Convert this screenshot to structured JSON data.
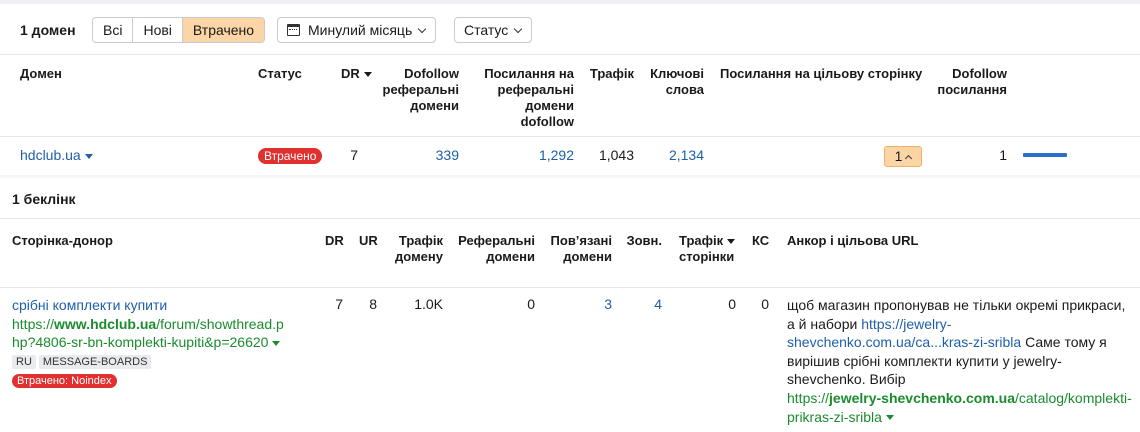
{
  "filters": {
    "count_label": "1 домен",
    "segments": [
      "Всі",
      "Нові",
      "Втрачено"
    ],
    "active_segment": "Втрачено",
    "period_label": "Минулий місяць",
    "status_label": "Статус"
  },
  "domains_table": {
    "headers": {
      "domain": "Домен",
      "status": "Статус",
      "dr": "DR",
      "dofollow_ref_domains": [
        "Dofollow",
        "реферальні",
        "домени"
      ],
      "links_to_ref_domains": [
        "Посилання на",
        "реферальні",
        "домени",
        "dofollow"
      ],
      "traffic": "Трафік",
      "keywords": [
        "Ключові",
        "слова"
      ],
      "links_to_target": "Посилання на цільову сторінку",
      "dofollow_links": [
        "Dofollow",
        "посилання"
      ]
    },
    "row": {
      "domain": "hdclub.ua",
      "status": "Втрачено",
      "dr": "7",
      "dofollow_ref_domains": "339",
      "links_to_ref_domains": "1,292",
      "traffic": "1,043",
      "keywords": "2,134",
      "links_to_target": "1",
      "dofollow_links": "1"
    }
  },
  "backlinks": {
    "title": "1 беклінк",
    "headers": {
      "donor_page": "Сторінка-донор",
      "dr": "DR",
      "ur": "UR",
      "domain_traffic": [
        "Трафік",
        "домену"
      ],
      "referring_domains": [
        "Реферальні",
        "домени"
      ],
      "linked_domains": [
        "Пов’язані",
        "домени"
      ],
      "external": "Зовн.",
      "page_traffic": [
        "Трафік",
        "сторінки"
      ],
      "kc": "КС",
      "anchor_target": "Анкор і цільова URL"
    },
    "row": {
      "page_title": "срібні комплекти купити",
      "url_prefix": "https://",
      "url_domain": "www.hdclub.ua",
      "url_line1_rest": "/forum/showthread.p",
      "url_line2": "hp?4806-sr-bn-komplekti-kupiti&p=26620",
      "tags": [
        "RU",
        "MESSAGE-BOARDS"
      ],
      "lost_badge": "Втрачено: Noindex",
      "dr": "7",
      "ur": "8",
      "domain_traffic": "1.0K",
      "referring_domains": "0",
      "linked_domains": "3",
      "external": "4",
      "page_traffic": "0",
      "kc": "0",
      "anchor_text_1": "щоб магазин пропонував не тільки окремі прикраси, а й набори ",
      "anchor_link": "https://jewelry-shevchenko.com.ua/ca...kras-zi-sribla",
      "anchor_text_2": " Саме тому я вирішив срібні комплекти купити у jewelry-shevchenko. Вибір",
      "target_prefix": "https://",
      "target_domain": "jewelry-shevchenko.com.ua",
      "target_rest_1": "/catalog/komple",
      "target_rest_2": "kti-prikras-zi-sribla"
    }
  },
  "colors": {
    "link": "#1f5fa8",
    "green_url": "#1a8c2e",
    "lost_red": "#e0302f",
    "active_orange": "#fbd5a6",
    "bar_blue": "#2a6fc9"
  }
}
